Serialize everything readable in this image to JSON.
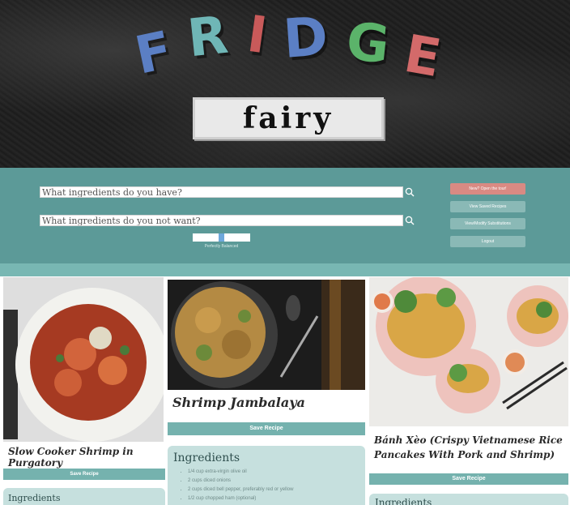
{
  "header": {
    "logo_letters": [
      {
        "char": "F",
        "color": "#5b7fc4"
      },
      {
        "char": "R",
        "color": "#6fb6b6"
      },
      {
        "char": "I",
        "color": "#c95a5a"
      },
      {
        "char": "D",
        "color": "#5b7fc4"
      },
      {
        "char": "G",
        "color": "#5bb36a"
      },
      {
        "char": "E",
        "color": "#d36a6a"
      }
    ],
    "subtitle": "fairy"
  },
  "search": {
    "have_placeholder": "What ingredients do you have?",
    "not_want_placeholder": "What ingredients do you not want?",
    "balance_label": "Perfectly Balanced",
    "balance_value": 0.5
  },
  "nav": {
    "tour": "New? Open the tour!",
    "saved": "View Saved Recipes",
    "substitutions": "View/Modify Substitutions",
    "logout": "Logout"
  },
  "recipes": [
    {
      "title": "Slow Cooker Shrimp in Purgatory",
      "save": "Save Recipe",
      "ingredients_heading": "Ingredients"
    },
    {
      "title": "Shrimp Jambalaya",
      "save": "Save Recipe",
      "ingredients_heading": "Ingredients",
      "ingredients": [
        "1/4 cup extra-virgin olive oil",
        "2 cups diced onions",
        "2 cups diced bell pepper, preferably red or yellow",
        "1/2 cup chopped ham (optional)"
      ]
    },
    {
      "title": "Bánh Xèo (Crispy Vietnamese Rice Pancakes With Pork and Shrimp)",
      "save": "Save Recipe",
      "ingredients_heading": "Ingredients"
    }
  ],
  "colors": {
    "band": "#5c9a98",
    "accent": "#75b2ae",
    "tour": "#d98a83"
  }
}
